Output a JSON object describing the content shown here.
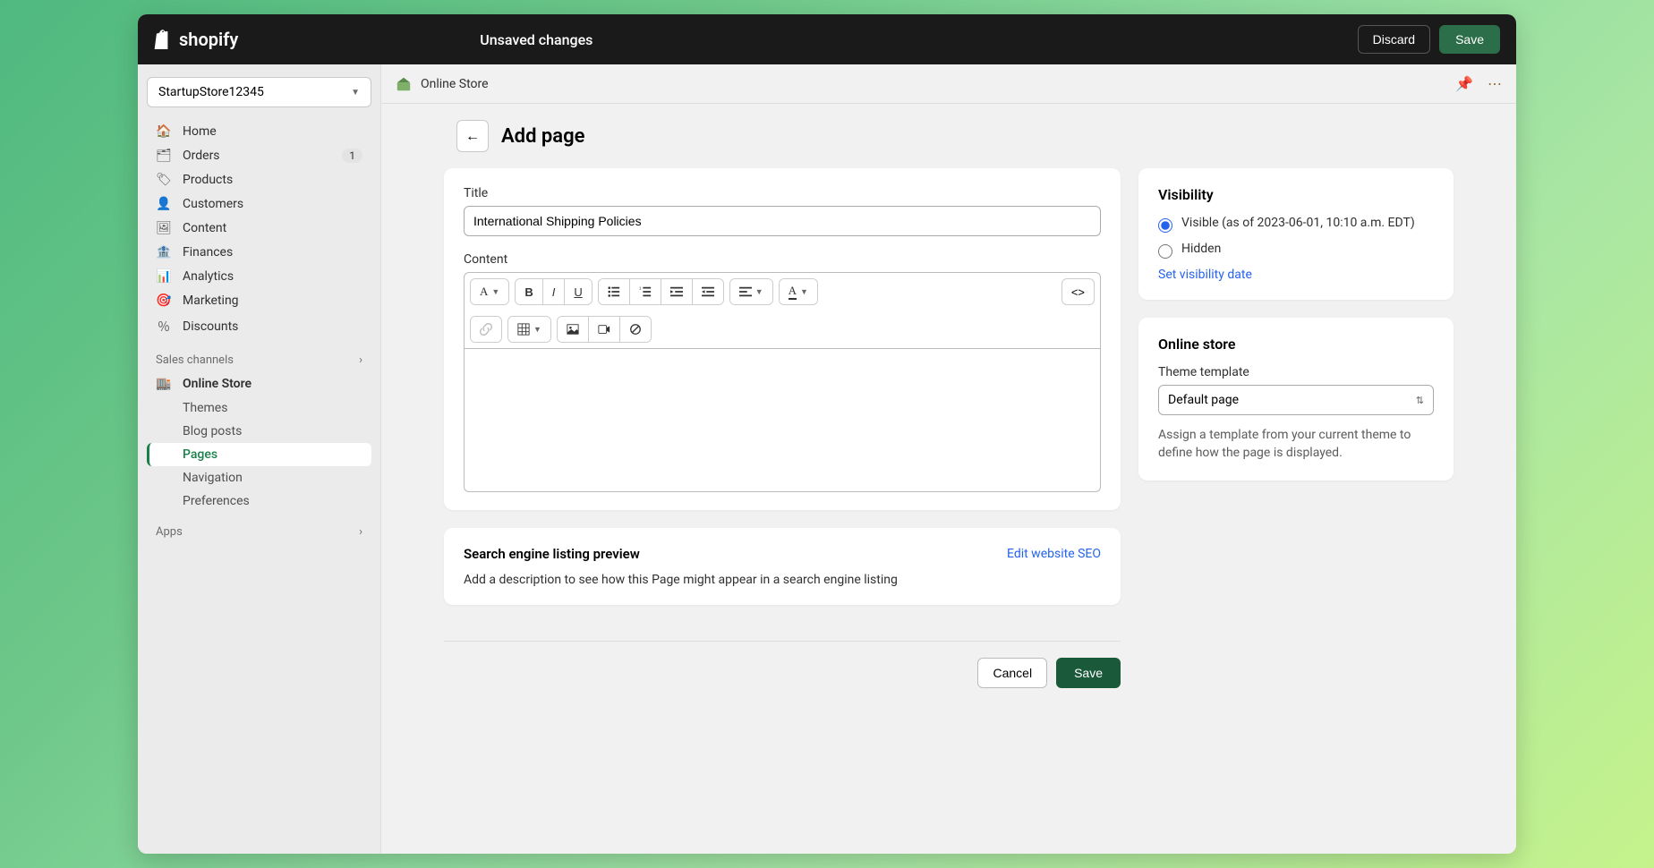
{
  "topbar": {
    "brand": "shopify",
    "unsaved": "Unsaved changes",
    "discard": "Discard",
    "save": "Save"
  },
  "sidebar": {
    "store_name": "StartupStore12345",
    "items": [
      {
        "label": "Home"
      },
      {
        "label": "Orders",
        "badge": "1"
      },
      {
        "label": "Products"
      },
      {
        "label": "Customers"
      },
      {
        "label": "Content"
      },
      {
        "label": "Finances"
      },
      {
        "label": "Analytics"
      },
      {
        "label": "Marketing"
      },
      {
        "label": "Discounts"
      }
    ],
    "section_channels": "Sales channels",
    "online_store": "Online Store",
    "subs": [
      {
        "label": "Themes"
      },
      {
        "label": "Blog posts"
      },
      {
        "label": "Pages"
      },
      {
        "label": "Navigation"
      },
      {
        "label": "Preferences"
      }
    ],
    "section_apps": "Apps"
  },
  "crumb": {
    "label": "Online Store"
  },
  "page": {
    "title": "Add page",
    "title_field_label": "Title",
    "title_field_value": "International Shipping Policies",
    "content_label": "Content"
  },
  "visibility": {
    "heading": "Visibility",
    "visible": "Visible (as of 2023-06-01, 10:10 a.m. EDT)",
    "hidden": "Hidden",
    "set_date": "Set visibility date"
  },
  "online_store_card": {
    "heading": "Online store",
    "theme_label": "Theme template",
    "theme_value": "Default page",
    "help": "Assign a template from your current theme to define how the page is displayed."
  },
  "seo": {
    "heading": "Search engine listing preview",
    "edit": "Edit website SEO",
    "desc": "Add a description to see how this Page might appear in a search engine listing"
  },
  "footer": {
    "cancel": "Cancel",
    "save": "Save"
  }
}
